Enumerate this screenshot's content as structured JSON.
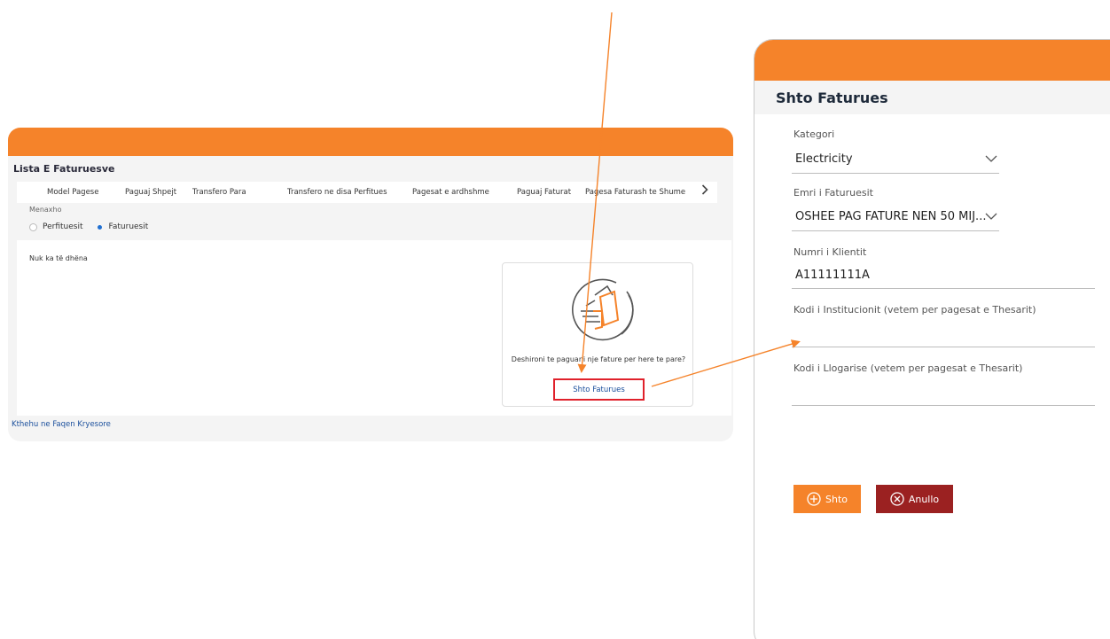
{
  "left": {
    "title": "Lista E Faturuesve",
    "tabs": [
      "Model Pagese",
      "Paguaj Shpejt",
      "Transfero Para",
      "Transfero ne disa Perfitues",
      "Pagesat e ardhshme",
      "Paguaj Faturat",
      "Pagesa Faturash te Shume"
    ],
    "manage_label": "Menaxho",
    "radios": [
      {
        "label": "Perfituesit",
        "selected": false
      },
      {
        "label": "Faturuesit",
        "selected": true
      }
    ],
    "no_data": "Nuk ka të dhëna",
    "empty_prompt": "Deshironi te paguani nje fature per here te pare?",
    "add_link": "Shto Faturues",
    "back_link": "Kthehu ne Faqen Kryesore"
  },
  "panel": {
    "title": "Shto Faturues",
    "category_label": "Kategori",
    "category_value": "Electricity",
    "biller_label": "Emri i Faturuesit",
    "biller_value": "OSHEE PAG FATURE NEN 50 MIJ...",
    "client_label": "Numri i Klientit",
    "client_value": "A11111111A",
    "institution_label": "Kodi i Institucionit (vetem per pagesat e Thesarit)",
    "institution_value": "",
    "account_label": "Kodi i Llogarise (vetem per pagesat e Thesarit)",
    "account_value": "",
    "add_button": "Shto",
    "cancel_button": "Anullo"
  },
  "colors": {
    "accent": "#f5832a",
    "cancel": "#9b2121",
    "link": "#1a4f9c",
    "highlight": "#e0212b"
  },
  "icons": {
    "tabs_next": "chevron-right-icon",
    "dropdown": "chevron-down-icon",
    "empty_state": "invoice-hand-icon",
    "add": "plus-circle-icon",
    "cancel": "x-circle-icon"
  }
}
